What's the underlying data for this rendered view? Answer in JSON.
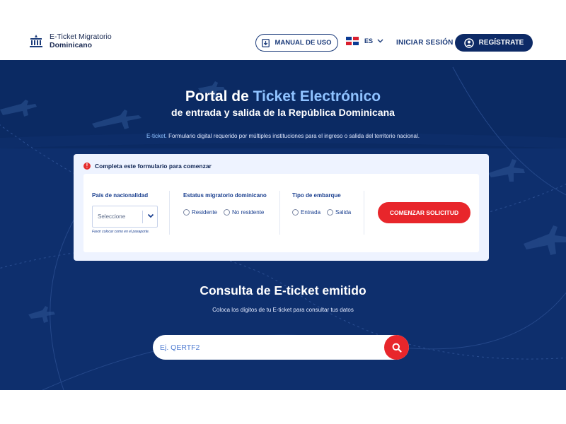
{
  "header": {
    "logo_line1": "E-Ticket Migratorio",
    "logo_line2": "Dominicano",
    "manual_label": "MANUAL DE USO",
    "language": "ES",
    "login_label": "INICIAR SESIÓN",
    "register_label": "REGÍSTRATE"
  },
  "hero": {
    "title_pre": "Portal de ",
    "title_accent": "Ticket Electrónico",
    "subtitle": "de entrada y salida de la República Dominicana",
    "desc_tag": "E-ticket.",
    "desc_text": " Formulario digital requerido por múltiples instituciones para el ingreso o salida del territorio nacional."
  },
  "form": {
    "heading": "Completa este formulario para comenzar",
    "nationality_label": "País de nacionalidad",
    "nationality_value": "Seleccione",
    "nationality_hint": "Favor colocar como en el pasaporte.",
    "status_label": "Estatus migratorio dominicano",
    "status_options": [
      "Residente",
      "No residente"
    ],
    "boarding_label": "Tipo de embarque",
    "boarding_options": [
      "Entrada",
      "Salida"
    ],
    "start_button": "COMENZAR SOLICITUD"
  },
  "consult": {
    "title": "Consulta de E-ticket emitido",
    "subtitle": "Coloca los dígitos de tu E-ticket para consultar tus datos",
    "placeholder": "Ej. QERTF2"
  },
  "colors": {
    "navy": "#0d2a66",
    "hero_bg": "#0e2f6d",
    "accent_red": "#e8262b",
    "accent_light_blue": "#8fc2ff"
  },
  "icons": {
    "logo": "government-building-icon",
    "manual": "document-download-icon",
    "flag": "dominican-republic-flag-icon",
    "user": "user-circle-icon",
    "search": "search-icon",
    "warning": "alert-icon"
  }
}
